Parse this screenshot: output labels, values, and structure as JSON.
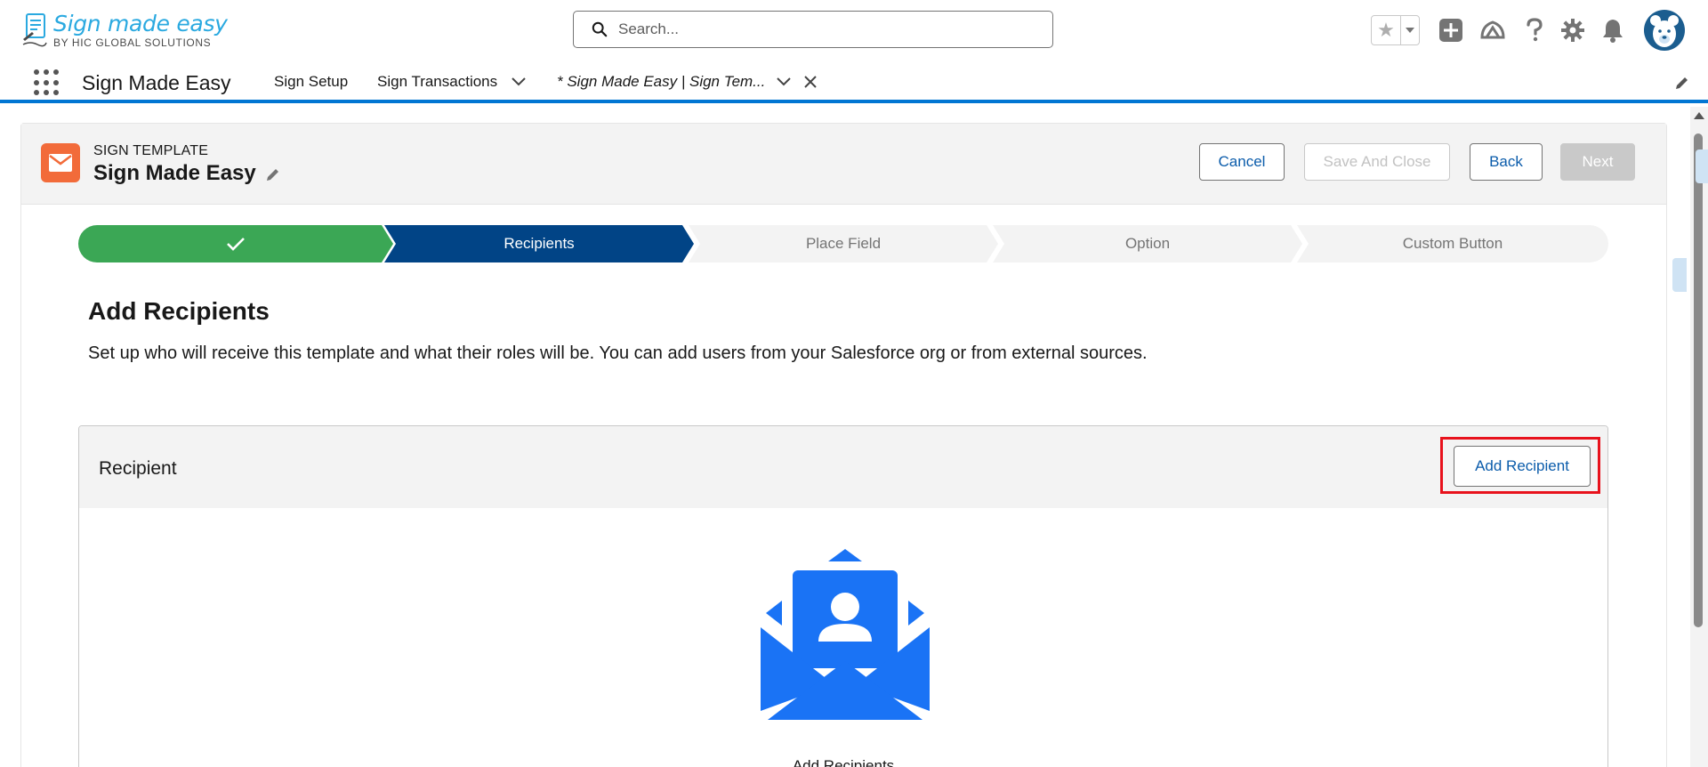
{
  "brand": {
    "logo_title": "Sign made easy",
    "logo_sub": "BY HIC GLOBAL SOLUTIONS"
  },
  "search": {
    "placeholder": "Search..."
  },
  "global_icons": [
    "star-icon",
    "chevron-down-icon",
    "add-icon",
    "trailhead-icon",
    "help-icon",
    "setup-gear-icon",
    "notification-bell-icon",
    "avatar"
  ],
  "nav": {
    "app_name": "Sign Made Easy",
    "items": [
      {
        "label": "Sign Setup"
      },
      {
        "label": "Sign Transactions"
      },
      {
        "label": "* Sign Made Easy | Sign Tem..."
      }
    ]
  },
  "header": {
    "eyebrow": "SIGN TEMPLATE",
    "title": "Sign Made Easy",
    "buttons": {
      "cancel": "Cancel",
      "save_close": "Save And Close",
      "back": "Back",
      "next": "Next"
    }
  },
  "path": {
    "steps": [
      {
        "label": "",
        "status": "complete"
      },
      {
        "label": "Recipients",
        "status": "current"
      },
      {
        "label": "Place Field",
        "status": "incomplete"
      },
      {
        "label": "Option",
        "status": "incomplete"
      },
      {
        "label": "Custom Button",
        "status": "incomplete"
      }
    ]
  },
  "section": {
    "title": "Add Recipients",
    "description": "Set up who will receive this template and what their roles will be. You can add users from your Salesforce org or from external sources."
  },
  "recipient_card": {
    "title": "Recipient",
    "add_button": "Add Recipient",
    "empty_label": "Add Recipients"
  },
  "colors": {
    "brand_blue": "#0176d3",
    "path_complete": "#3ba755",
    "path_current": "#014486",
    "path_incomplete": "#f3f3f3",
    "highlight": "#e8121c",
    "envelope": "#1a73f5",
    "template_icon": "#f26b3a"
  }
}
